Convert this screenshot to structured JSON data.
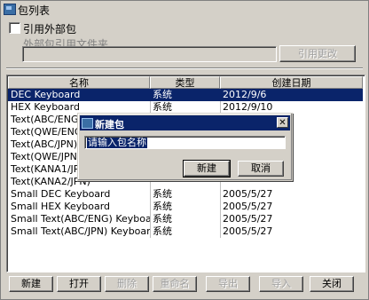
{
  "window": {
    "title": "包列表"
  },
  "external": {
    "checkbox_label": "引用外部包",
    "folder_label": "外部包引用文件夹",
    "folder_value": "",
    "apply_button": "引用更改"
  },
  "table": {
    "columns": [
      "名称",
      "类型",
      "创建日期"
    ],
    "rows": [
      {
        "name": "DEC Keyboard",
        "type": "系统",
        "date": "2012/9/6",
        "selected": true
      },
      {
        "name": "HEX Keyboard",
        "type": "系统",
        "date": "2012/9/10"
      },
      {
        "name": "Text(ABC/ENG) Ke",
        "type": "",
        "date": ""
      },
      {
        "name": "Text(QWE/ENG) K",
        "type": "",
        "date": ""
      },
      {
        "name": "Text(ABC/JPN) Ke",
        "type": "",
        "date": ""
      },
      {
        "name": "Text(QWE/JPN) Ke",
        "type": "",
        "date": ""
      },
      {
        "name": "Text(KANA1/JPN)",
        "type": "",
        "date": ""
      },
      {
        "name": "Text(KANA2/JPN)",
        "type": "",
        "date": ""
      },
      {
        "name": "Small DEC Keyboard",
        "type": "系统",
        "date": "2005/5/27"
      },
      {
        "name": "Small HEX Keyboard",
        "type": "系统",
        "date": "2005/5/27"
      },
      {
        "name": "Small Text(ABC/ENG) Keyboard",
        "type": "系统",
        "date": "2005/5/27"
      },
      {
        "name": "Small Text(ABC/JPN) Keyboard",
        "type": "系统",
        "date": "2005/5/27"
      }
    ]
  },
  "buttons": {
    "new": "新建",
    "open": "打开",
    "delete": "删除",
    "rename": "重命名",
    "export": "导出",
    "import": "导入",
    "close": "关闭"
  },
  "dialog": {
    "title": "新建包",
    "input_value": "请输入包名称",
    "ok": "新建",
    "cancel": "取消"
  },
  "colors": {
    "selection": "#0a246a",
    "face": "#d4d0c8"
  }
}
